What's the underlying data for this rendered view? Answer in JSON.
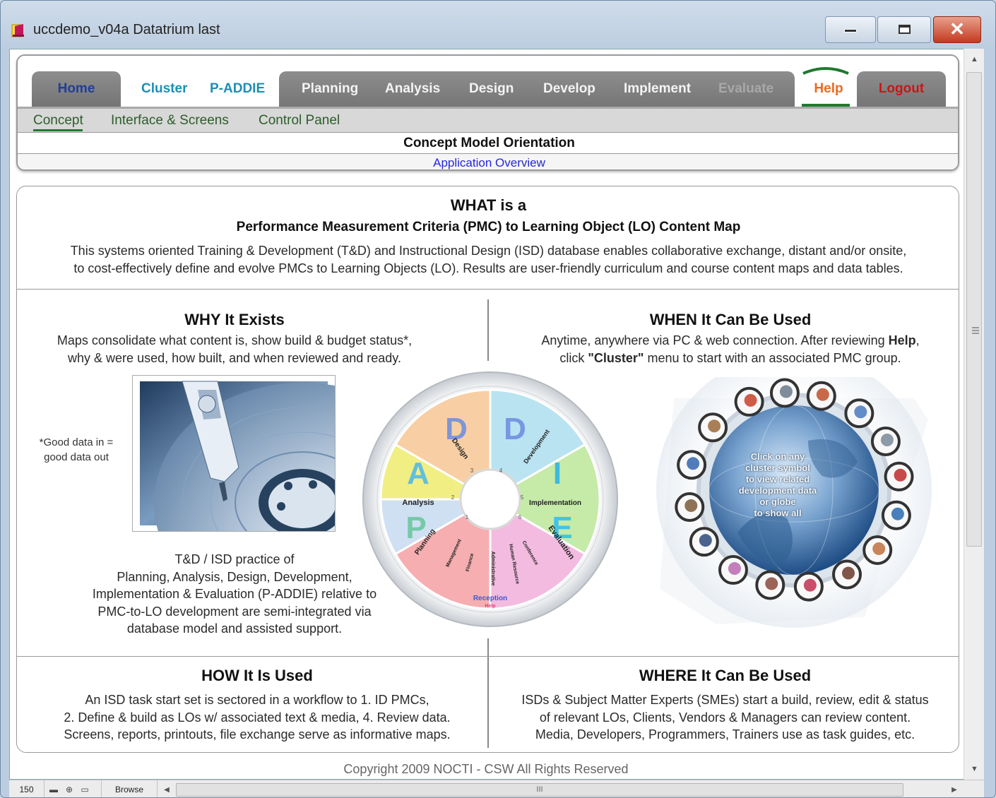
{
  "window": {
    "title": "uccdemo_v04a Datatrium last",
    "buttons": {
      "minimize_glyph": "—",
      "maximize_glyph": "▭",
      "close_glyph": "✕"
    }
  },
  "nav": {
    "tabs": {
      "home": "Home",
      "cluster": "Cluster",
      "paddie": "P-ADDIE",
      "planning": "Planning",
      "analysis": "Analysis",
      "design": "Design",
      "develop": "Develop",
      "implement": "Implement",
      "evaluate": "Evaluate",
      "help": "Help",
      "logout": "Logout"
    },
    "subtabs": {
      "concept": "Concept",
      "interface": "Interface & Screens",
      "control": "Control Panel"
    },
    "page_heading": "Concept Model Orientation",
    "overview_link": "Application Overview"
  },
  "content": {
    "what": {
      "title": "WHAT is a",
      "subtitle": "Performance Measurement Criteria (PMC) to Learning Object (LO) Content Map",
      "line1": "This systems oriented Training & Development (T&D) and Instructional Design (ISD) database enables collaborative exchange, distant and/or onsite,",
      "line2": "to cost-effectively define and evolve PMCs to Learning Objects (LO).  Results are user-friendly curriculum and course content maps and data tables."
    },
    "why": {
      "title": "WHY It Exists",
      "line1": "Maps consolidate what content is, show build & budget status*,",
      "line2": "why & were used, how built, and when reviewed and ready.",
      "note1": "*Good data in =",
      "note2": "good data out",
      "practice": [
        "T&D / ISD practice of",
        "Planning, Analysis, Design, Development,",
        "Implementation & Evaluation (P-ADDIE) relative to",
        "PMC-to-LO development are semi-integrated via",
        "database model and assisted support."
      ]
    },
    "when": {
      "title": "WHEN It Can Be Used",
      "line1_a": "Anytime, anywhere via PC & web connection.  After reviewing ",
      "line1_b": "Help",
      "line1_c": ",",
      "line2_a": "click ",
      "line2_b": "\"Cluster\"",
      "line2_c": " menu to start with an associated PMC group."
    },
    "wheel": {
      "letters": [
        "P",
        "A",
        "D",
        "D",
        "I",
        "E"
      ],
      "labels": [
        "Planning",
        "Analysis",
        "Design",
        "Development",
        "Implementation",
        "Evaluation"
      ],
      "numbers": [
        "1",
        "2",
        "3",
        "4",
        "5",
        "6"
      ],
      "inner_labels": [
        "Management",
        "Finance",
        "Administrative",
        "Human Resource",
        "Conference"
      ],
      "reception": "Reception",
      "help": "Help"
    },
    "globe": {
      "lines": [
        "Click on any",
        "cluster symbol",
        "to view related",
        "development data",
        "or globe",
        "to show all"
      ]
    },
    "how": {
      "title": "HOW It Is Used",
      "line1": "An ISD task start set is sectored in a workflow to 1. ID PMCs,",
      "line2": "2. Define & build as LOs w/ associated text & media, 4. Review data.",
      "line3": "Screens, reports, printouts, file exchange serve as informative maps."
    },
    "where": {
      "title": "WHERE It Can Be Used",
      "line1": "ISDs & Subject Matter Experts (SMEs) start a build, review, edit & status",
      "line2": "of relevant LOs, Clients, Vendors & Managers can review content.",
      "line3": "Media, Developers, Programmers, Trainers use as task guides, etc."
    },
    "footer": "Copyright 2009 NOCTI - CSW  All Rights Reserved"
  },
  "statusbar": {
    "zoom": "150",
    "mode": "Browse",
    "grip": "III"
  },
  "colors": {
    "tab_gray": "#808080",
    "home_blue": "#1e3f9a",
    "cluster_teal": "#1c8fb7",
    "help_orange": "#ee6a1c",
    "logout_red": "#cc1515",
    "concept_green": "#2d5d2a",
    "link_blue": "#2626dd"
  }
}
